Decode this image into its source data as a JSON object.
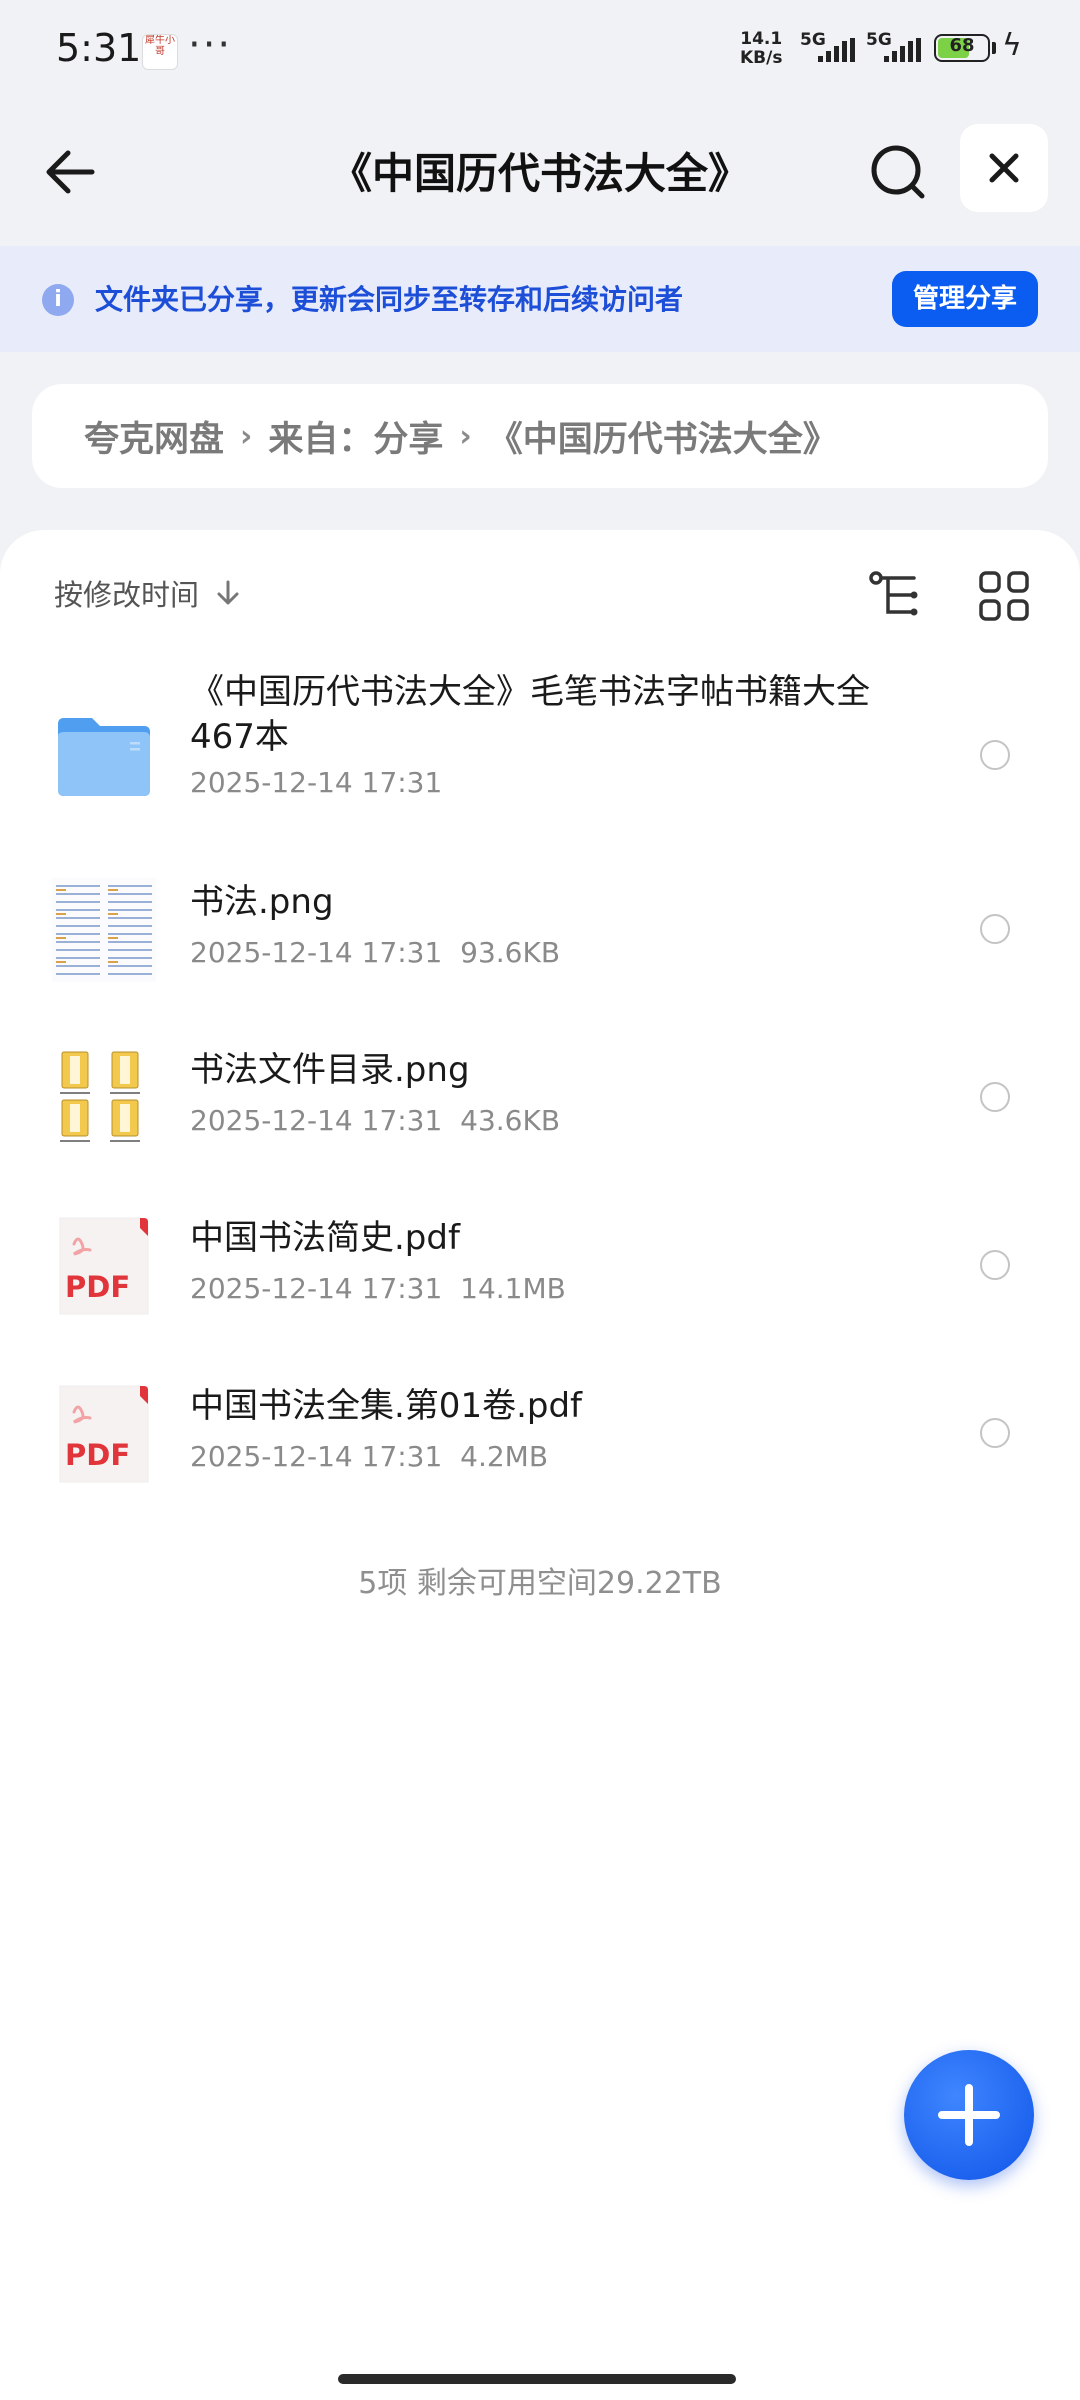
{
  "status_bar": {
    "time": "5:31",
    "app_badge": "犀牛小哥",
    "more": "···",
    "net_speed_value": "14.1",
    "net_speed_unit": "KB/s",
    "sim1": "5G",
    "sim2": "5G",
    "battery": "68",
    "battery_level": 0.68
  },
  "header": {
    "title": "《中国历代书法大全》",
    "back_icon": "arrow-left-icon",
    "search_icon": "search-icon",
    "close_icon": "close-icon"
  },
  "share_banner": {
    "message": "文件夹已分享，更新会同步至转存和后续访问者",
    "button_label": "管理分享",
    "info_icon": "info-icon"
  },
  "breadcrumb": {
    "items": [
      "夸克网盘",
      "来自：分享",
      "《中国历代书法大全》"
    ],
    "separator": "›"
  },
  "toolbar": {
    "sort_label": "按修改时间",
    "sort_icon": "arrow-down-icon",
    "tree_icon": "tree-view-icon",
    "grid_icon": "grid-view-icon"
  },
  "files": [
    {
      "name": "《中国历代书法大全》毛笔书法字帖书籍大全467本",
      "date": "2025-12-14 17:31",
      "size": "",
      "type": "folder"
    },
    {
      "name": "书法.png",
      "date": "2025-12-14 17:31",
      "size": "93.6KB",
      "type": "image"
    },
    {
      "name": "书法文件目录.png",
      "date": "2025-12-14 17:31",
      "size": "43.6KB",
      "type": "image"
    },
    {
      "name": "中国书法简史.pdf",
      "date": "2025-12-14 17:31",
      "size": "14.1MB",
      "type": "pdf"
    },
    {
      "name": "中国书法全集.第01卷.pdf",
      "date": "2025-12-14 17:31",
      "size": "4.2MB",
      "type": "pdf"
    }
  ],
  "pdf_label": "PDF",
  "summary": "5项 剩余可用空间29.22TB",
  "fab_icon": "plus-icon",
  "colors": {
    "accent": "#0b5cf0",
    "banner_bg": "#e8ecfa",
    "pdf_red": "#e0353b",
    "folder_blue": "#5aa8f2"
  }
}
